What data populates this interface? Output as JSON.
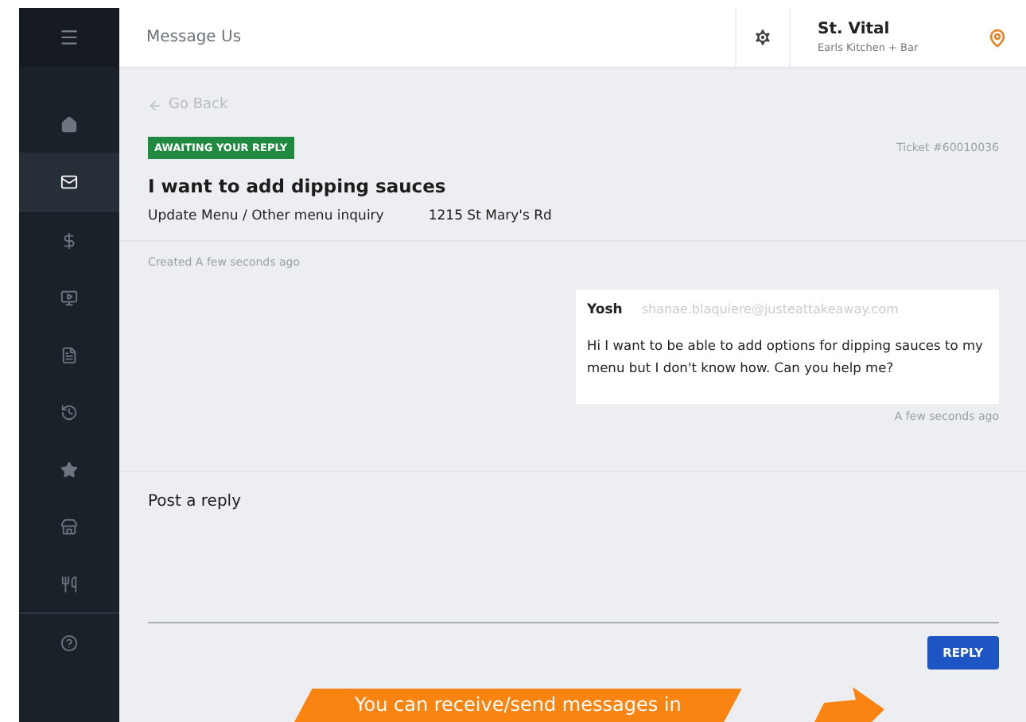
{
  "sidebar": {
    "items": [
      {
        "kind": "home",
        "selected": false
      },
      {
        "kind": "mail",
        "selected": true
      },
      {
        "kind": "dollar",
        "selected": false
      },
      {
        "kind": "video",
        "selected": false
      },
      {
        "kind": "document",
        "selected": false
      },
      {
        "kind": "history",
        "selected": false
      },
      {
        "kind": "star",
        "selected": false
      },
      {
        "kind": "store",
        "selected": false
      },
      {
        "kind": "utensils",
        "selected": false
      },
      {
        "kind": "help",
        "selected": false
      }
    ]
  },
  "header": {
    "title": "Message Us",
    "location": {
      "name": "St. Vital",
      "subtitle": "Earls Kitchen + Bar"
    }
  },
  "ticket": {
    "back": "Go Back",
    "status": "AWAITING YOUR REPLY",
    "number": "Ticket #60010036",
    "subject": "I want to add dipping sauces",
    "category": "Update Menu / Other menu inquiry",
    "address": "1215 St Mary's Rd",
    "created": "Created A few seconds ago"
  },
  "messages": [
    {
      "author": "Yosh",
      "email": "shanae.blaquiere@justeattakeaway.com",
      "body": "Hi I want to be able to add options for dipping sauces to my menu but I don't know how. Can you help me?",
      "time": "A few seconds ago"
    }
  ],
  "reply": {
    "label": "Post a reply",
    "button": "REPLY"
  },
  "callout": {
    "text": "You can receive/send messages in"
  }
}
